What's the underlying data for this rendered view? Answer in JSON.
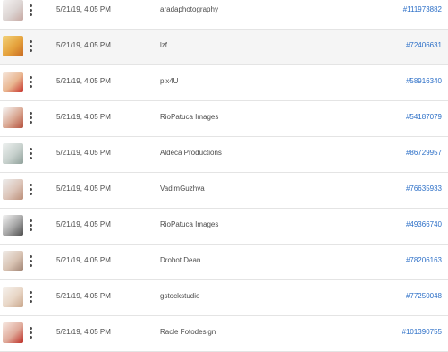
{
  "rows": [
    {
      "date": "5/21/19, 4:05 PM",
      "author": "aradaphotography",
      "asset_id": "#111973882",
      "thumb_colors": [
        "#f4f2f2",
        "#dcd4d2",
        "#c6a8a2"
      ]
    },
    {
      "date": "5/21/19, 4:05 PM",
      "author": "lzf",
      "asset_id": "#72406631",
      "thumb_colors": [
        "#f2d27a",
        "#e5a23c",
        "#c86a22"
      ]
    },
    {
      "date": "5/21/19, 4:05 PM",
      "author": "pix4U",
      "asset_id": "#58916340",
      "thumb_colors": [
        "#f6e9df",
        "#e9b58f",
        "#c7342c"
      ]
    },
    {
      "date": "5/21/19, 4:05 PM",
      "author": "RioPatuca Images",
      "asset_id": "#54187079",
      "thumb_colors": [
        "#f6f6f6",
        "#d9a691",
        "#b5523e"
      ]
    },
    {
      "date": "5/21/19, 4:05 PM",
      "author": "Aldeca Productions",
      "asset_id": "#86729957",
      "thumb_colors": [
        "#eef1f0",
        "#c6d0cc",
        "#8fa09a"
      ]
    },
    {
      "date": "5/21/19, 4:05 PM",
      "author": "VadimGuzhva",
      "asset_id": "#76635933",
      "thumb_colors": [
        "#ededed",
        "#dcc4b8",
        "#bb8e78"
      ]
    },
    {
      "date": "5/21/19, 4:05 PM",
      "author": "RioPatuca Images",
      "asset_id": "#49366740",
      "thumb_colors": [
        "#f4f4f4",
        "#a5a5a5",
        "#4e4e4e"
      ]
    },
    {
      "date": "5/21/19, 4:05 PM",
      "author": "Drobot Dean",
      "asset_id": "#78206163",
      "thumb_colors": [
        "#f0ece8",
        "#d8c2b2",
        "#9f8272"
      ]
    },
    {
      "date": "5/21/19, 4:05 PM",
      "author": "gstockstudio",
      "asset_id": "#77250048",
      "thumb_colors": [
        "#f6f2ee",
        "#e8d6c6",
        "#c9a78c"
      ]
    },
    {
      "date": "5/21/19, 4:05 PM",
      "author": "Racle Fotodesign",
      "asset_id": "#101390755",
      "thumb_colors": [
        "#f7e9e2",
        "#dfa999",
        "#bd2d25"
      ]
    }
  ],
  "hovered_row": 1
}
